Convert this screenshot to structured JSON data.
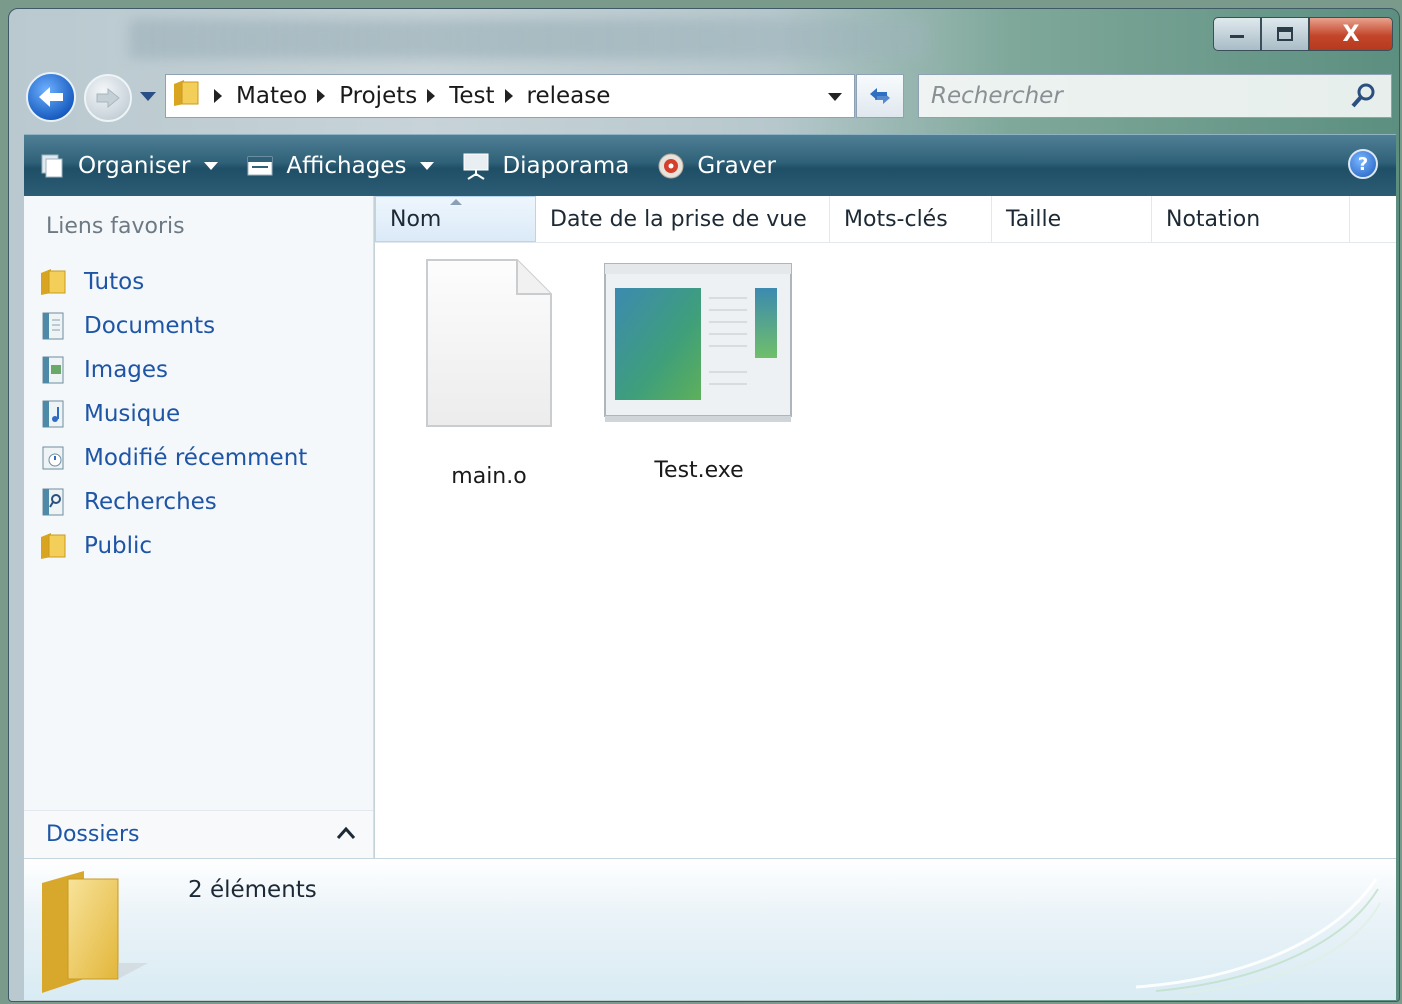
{
  "window": {
    "caption_buttons": [
      "minimize",
      "maximize",
      "close"
    ],
    "close_glyph": "X"
  },
  "nav": {
    "breadcrumbs": [
      "Mateo",
      "Projets",
      "Test",
      "release"
    ]
  },
  "search": {
    "placeholder": "Rechercher"
  },
  "toolbar": {
    "organiser": "Organiser",
    "affichages": "Affichages",
    "diaporama": "Diaporama",
    "graver": "Graver",
    "help": "?"
  },
  "sidebar": {
    "header": "Liens favoris",
    "items": [
      {
        "label": "Tutos",
        "icon": "folder-icon"
      },
      {
        "label": "Documents",
        "icon": "documents-icon"
      },
      {
        "label": "Images",
        "icon": "images-icon"
      },
      {
        "label": "Musique",
        "icon": "music-icon"
      },
      {
        "label": "Modifié récemment",
        "icon": "recent-icon"
      },
      {
        "label": "Recherches",
        "icon": "searches-icon"
      },
      {
        "label": "Public",
        "icon": "folder-icon"
      }
    ],
    "folders_label": "Dossiers"
  },
  "columns": [
    "Nom",
    "Date de la prise de vue",
    "Mots-clés",
    "Taille",
    "Notation"
  ],
  "files": [
    {
      "name": "main.o",
      "icon": "blank-file-icon"
    },
    {
      "name": "Test.exe",
      "icon": "exe-window-icon"
    }
  ],
  "details": {
    "count": "2 éléments"
  },
  "colors": {
    "command_bar": "#2f6178",
    "link_blue": "#1e55a5",
    "sorted_header": "#dbeaf8"
  }
}
